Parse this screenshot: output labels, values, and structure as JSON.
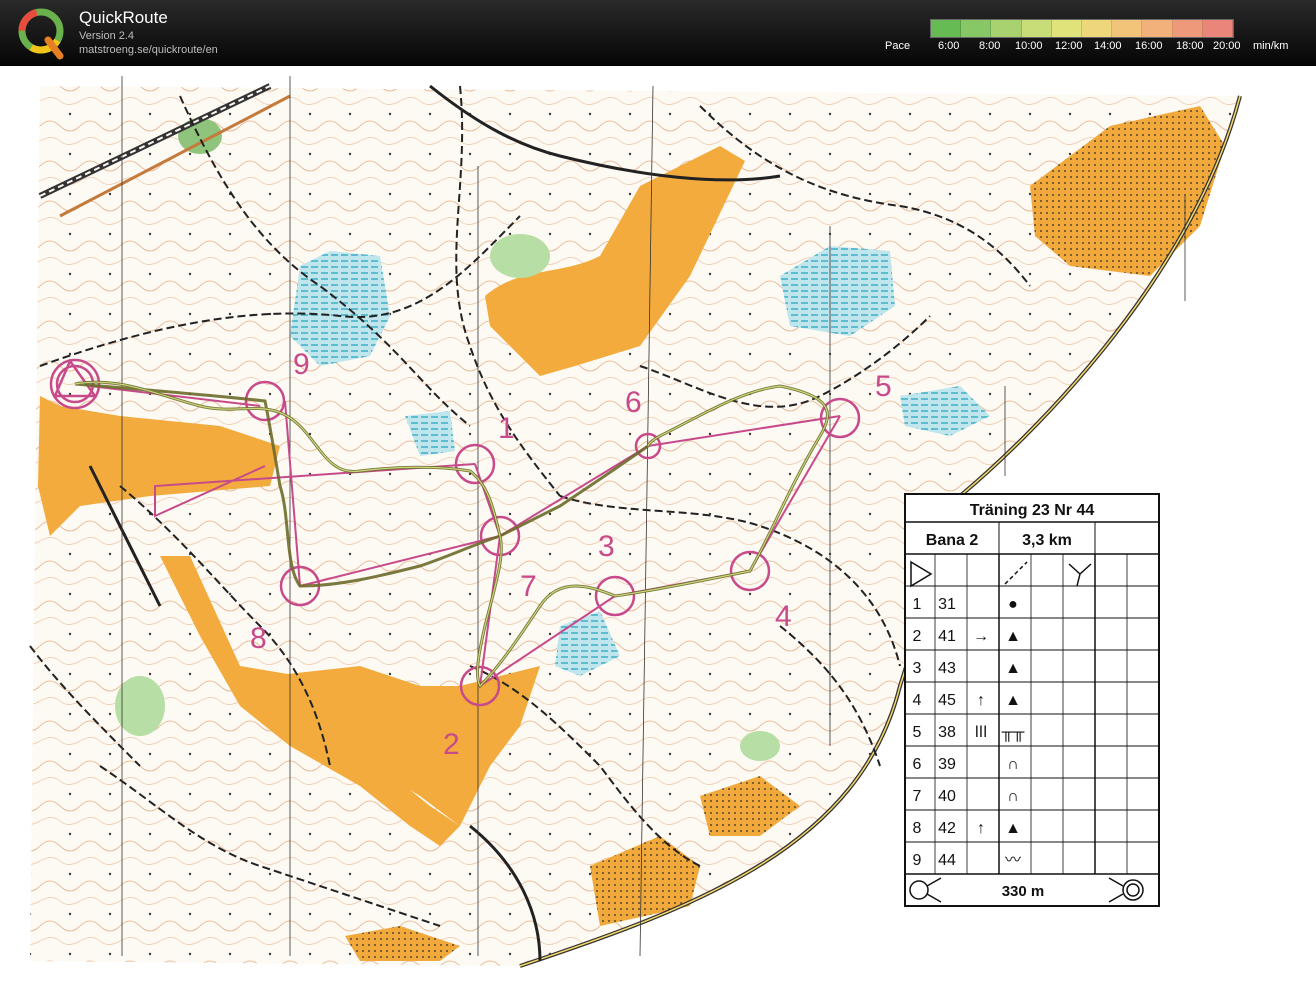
{
  "app": {
    "name": "QuickRoute",
    "version": "Version 2.4",
    "url": "matstroeng.se/quickroute/en"
  },
  "legend": {
    "label": "Pace",
    "unit": "min/km",
    "ticks": [
      "6:00",
      "8:00",
      "10:00",
      "12:00",
      "14:00",
      "16:00",
      "18:00",
      "20:00"
    ],
    "colors": [
      "#66bb55",
      "#88c766",
      "#a8d270",
      "#c8dd77",
      "#e0e27a",
      "#eed67a",
      "#f2c47a",
      "#f2b07a",
      "#ee9a7a",
      "#ea857a"
    ]
  },
  "map": {
    "controls": [
      {
        "number": "1"
      },
      {
        "number": "2"
      },
      {
        "number": "3"
      },
      {
        "number": "4"
      },
      {
        "number": "5"
      },
      {
        "number": "6"
      },
      {
        "number": "7"
      },
      {
        "number": "8"
      },
      {
        "number": "9"
      }
    ],
    "course_color": "#c74a8a",
    "route_color": "#6b6a2a"
  },
  "description_sheet": {
    "event_title": "Träning 23 Nr 44",
    "course_name": "Bana 2",
    "course_length": "3,3 km",
    "rows": [
      {
        "order": "1",
        "code": "31",
        "direction": "",
        "symbol": "●"
      },
      {
        "order": "2",
        "code": "41",
        "direction": "→",
        "symbol": "▲"
      },
      {
        "order": "3",
        "code": "43",
        "direction": "",
        "symbol": "▲"
      },
      {
        "order": "4",
        "code": "45",
        "direction": "↑",
        "symbol": "▲"
      },
      {
        "order": "5",
        "code": "38",
        "direction": "ǀǀǀ",
        "symbol": "╥╥"
      },
      {
        "order": "6",
        "code": "39",
        "direction": "",
        "symbol": "∩"
      },
      {
        "order": "7",
        "code": "40",
        "direction": "",
        "symbol": "∩"
      },
      {
        "order": "8",
        "code": "42",
        "direction": "↑",
        "symbol": "▲"
      },
      {
        "order": "9",
        "code": "44",
        "direction": "",
        "symbol": "〰"
      }
    ],
    "finish_distance": "330 m"
  }
}
